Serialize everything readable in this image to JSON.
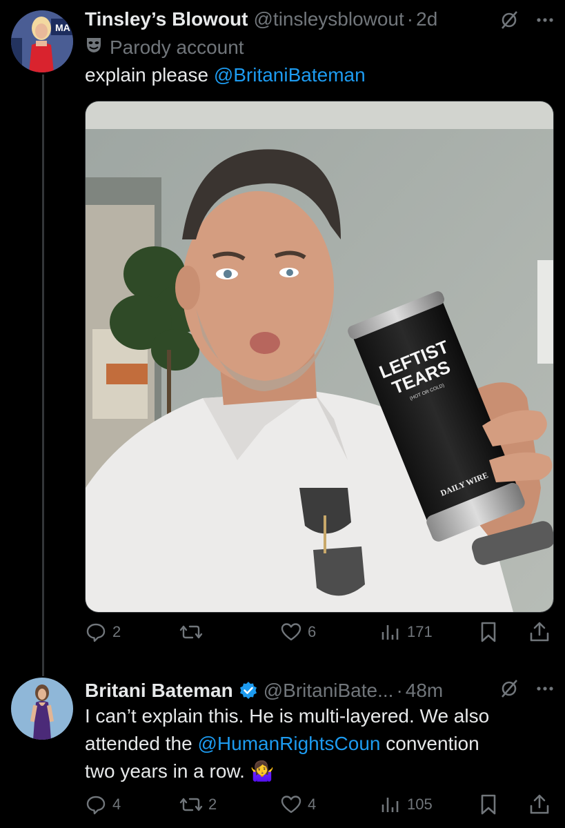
{
  "tweet1": {
    "name": "Tinsley’s Blowout",
    "handle": "@tinsleysblowout",
    "sep": "·",
    "time": "2d",
    "label": "Parody account",
    "text": "explain please ",
    "mention": "@BritaniBateman",
    "image": {
      "tumbler_line1": "LEFTIST",
      "tumbler_line2": "TEARS",
      "tumbler_small": "(HOT OR COLD)",
      "tumbler_brand": "DAILY WIRE"
    },
    "actions": {
      "replies": "2",
      "reposts": "",
      "likes": "6",
      "views": "171"
    }
  },
  "tweet2": {
    "name": "Britani Bateman",
    "handle": "@BritaniBate...",
    "sep": "·",
    "time": "48m",
    "text_line1": "I can’t explain this. He is multi-layered. We also",
    "text_line2_pre": "attended the ",
    "text_line2_mention": "@HumanRightsCoun",
    "text_line2_post": " convention",
    "text_line3": "two years in a row. ",
    "emoji": "🤷‍♀️",
    "actions": {
      "replies": "4",
      "reposts": "2",
      "likes": "4",
      "views": "105"
    }
  },
  "colors": {
    "background": "#000000",
    "text": "#e7e9ea",
    "muted": "#71767b",
    "link": "#1d9bf0",
    "verified": "#1d9bf0"
  },
  "icons": [
    "grok-icon",
    "more-icon",
    "parody-mask-icon",
    "reply-icon",
    "repost-icon",
    "like-icon",
    "views-icon",
    "bookmark-icon",
    "share-icon",
    "verified-badge-icon"
  ]
}
